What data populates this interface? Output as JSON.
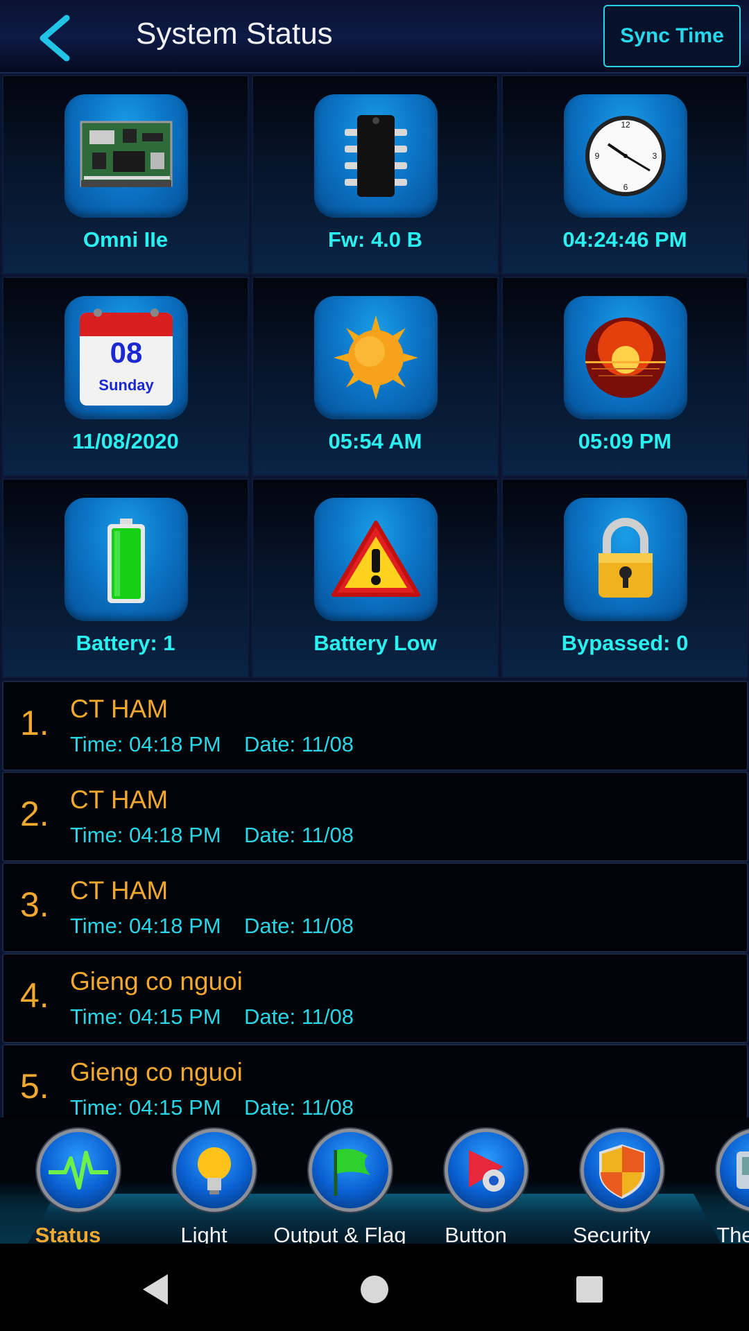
{
  "header": {
    "title": "System Status",
    "sync_label": "Sync Time"
  },
  "tiles": [
    {
      "label": "Omni IIe",
      "icon": "controller-board-icon"
    },
    {
      "label": "Fw: 4.0 B",
      "icon": "chip-icon"
    },
    {
      "label": "04:24:46 PM",
      "icon": "clock-icon"
    },
    {
      "label": "11/08/2020",
      "icon": "calendar-icon",
      "day": "08",
      "weekday": "Sunday"
    },
    {
      "label": "05:54 AM",
      "icon": "sunrise-sun-icon"
    },
    {
      "label": "05:09 PM",
      "icon": "sunset-icon"
    },
    {
      "label": "Battery:  1",
      "icon": "battery-icon"
    },
    {
      "label": "Battery Low",
      "icon": "warning-icon"
    },
    {
      "label": "Bypassed: 0",
      "icon": "padlock-icon"
    }
  ],
  "events": [
    {
      "num": "1.",
      "name": "CT HAM",
      "time": "Time: 04:18 PM",
      "date": "Date: 11/08"
    },
    {
      "num": "2.",
      "name": "CT HAM",
      "time": "Time: 04:18 PM",
      "date": "Date: 11/08"
    },
    {
      "num": "3.",
      "name": "CT HAM",
      "time": "Time: 04:18 PM",
      "date": "Date: 11/08"
    },
    {
      "num": "4.",
      "name": "Gieng co nguoi",
      "time": "Time: 04:15 PM",
      "date": "Date: 11/08"
    },
    {
      "num": "5.",
      "name": "Gieng co nguoi",
      "time": "Time: 04:15 PM",
      "date": "Date: 11/08"
    }
  ],
  "nav": [
    {
      "label": "Status",
      "icon": "pulse-icon",
      "active": true
    },
    {
      "label": "Light",
      "icon": "bulb-icon"
    },
    {
      "label": "Output & Flag",
      "icon": "flag-icon"
    },
    {
      "label": "Button",
      "icon": "button-play-icon"
    },
    {
      "label": "Security",
      "icon": "shield-icon"
    },
    {
      "label": "Therm",
      "icon": "thermostat-icon"
    }
  ],
  "colors": {
    "accent_cyan": "#2af0f0",
    "accent_orange": "#f0a830",
    "tile_blue": "#0c76c8"
  }
}
